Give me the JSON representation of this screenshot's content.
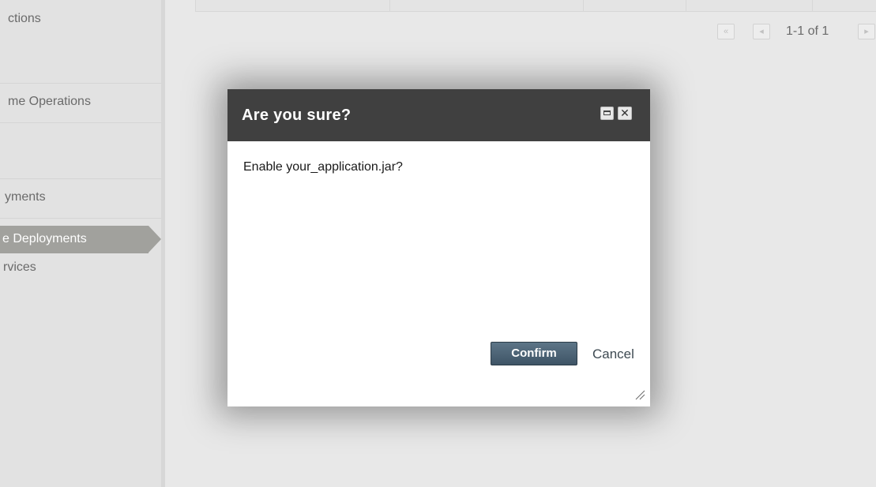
{
  "sidebar": {
    "items": [
      {
        "label": "ctions"
      },
      {
        "label": "me Operations"
      },
      {
        "label": "yments"
      },
      {
        "label": "e Deployments",
        "active": true
      },
      {
        "label": "rvices"
      }
    ]
  },
  "main": {
    "pager": {
      "range_text": "1-1 of 1",
      "first_icon": "double-chevron-left-icon",
      "prev_icon": "triangle-left-icon",
      "next_icon": "triangle-right-icon"
    }
  },
  "dialog": {
    "title": "Are you sure?",
    "message": "Enable your_application.jar?",
    "confirm_label": "Confirm",
    "cancel_label": "Cancel",
    "close_glyph": "✕",
    "maximize_icon": "window-maximize-icon",
    "colors": {
      "header_bg": "#404040",
      "confirm_bg": "#4a6072"
    }
  }
}
